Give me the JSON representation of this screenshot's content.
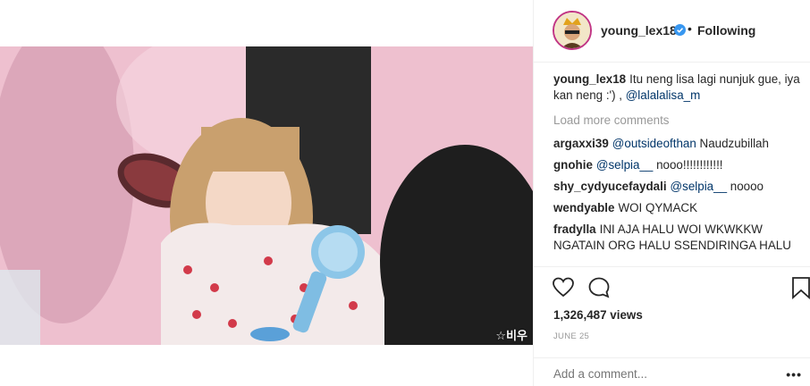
{
  "post": {
    "username": "young_lex18",
    "follow_status": "Following",
    "separator": "•",
    "caption_text": "Itu neng lisa lagi nunjuk gue, iya kan neng :') , ",
    "caption_mention": "@lalalalisa_m",
    "load_more": "Load more comments",
    "views": "1,326,487 views",
    "date": "JUNE 25",
    "add_comment_placeholder": "Add a comment...",
    "more_label": "•••",
    "video_watermark": "☆비우"
  },
  "comments": [
    {
      "user": "argaxxi39",
      "mention": "@outsideofthan",
      "text": " Naudzubillah"
    },
    {
      "user": "gnohie",
      "mention": "@selpia__",
      "text": " nooo!!!!!!!!!!!!"
    },
    {
      "user": "shy_cydyucefaydali",
      "mention": "@selpia__",
      "text": " noooo"
    },
    {
      "user": "wendyable",
      "mention": "",
      "text": "WOI QYMACK"
    },
    {
      "user": "fradylla",
      "mention": "",
      "text": "INI AJA HALU WOI WKWKKW NGATAIN ORG HALU SSENDIRINGA HALU"
    }
  ],
  "icons": {
    "verified": "verified-badge-icon",
    "like": "heart-icon",
    "comment": "comment-bubble-icon",
    "save": "bookmark-icon",
    "more": "more-options-icon"
  },
  "colors": {
    "mention": "#003569",
    "verified": "#3897f0",
    "muted": "#999999",
    "text": "#262626"
  }
}
